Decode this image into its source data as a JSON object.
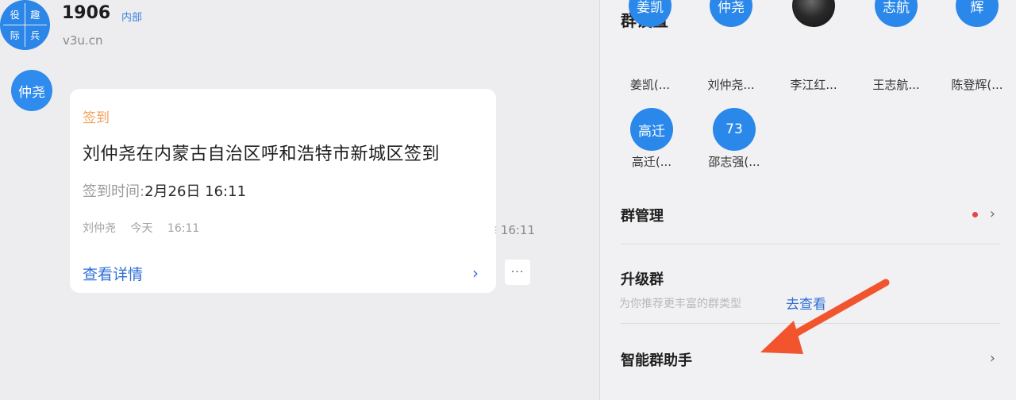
{
  "chat": {
    "group": {
      "avatar_chars": [
        "役",
        "趣",
        "际",
        "兵"
      ],
      "name": "1906",
      "tag": "内部",
      "subtitle": "v3u.cn"
    },
    "message": {
      "sender_avatar": "仲尧",
      "card": {
        "tag": "签到",
        "title": "刘仲尧在内蒙古自治区呼和浩特市新城区签到",
        "time_label": "签到时间:",
        "time_value": "2月26日 16:11",
        "meta_sender": "刘仲尧",
        "meta_day": "今天",
        "meta_time": "16:11",
        "link": "查看详情"
      },
      "time": "16:11",
      "more": "···"
    }
  },
  "settings": {
    "title": "群设置",
    "members": [
      {
        "avatar": "姜凯",
        "name": "姜凯(...",
        "photo": false
      },
      {
        "avatar": "仲尧",
        "name": "刘仲尧...",
        "photo": false
      },
      {
        "avatar": "",
        "name": "李江红...",
        "photo": true
      },
      {
        "avatar": "志航",
        "name": "王志航...",
        "photo": false
      },
      {
        "avatar": "辉",
        "name": "陈登辉(...",
        "photo": false
      },
      {
        "avatar": "高迁",
        "name": "高迁(...",
        "photo": false
      },
      {
        "avatar": "73",
        "name": "邵志强(...",
        "photo": false
      }
    ],
    "group_management": "群管理",
    "upgrade": {
      "label": "升级群",
      "description": "为你推荐更丰富的群类型",
      "action": "去查看"
    },
    "assistant": "智能群助手"
  },
  "colors": {
    "accent_blue": "#2a88ea",
    "link_blue": "#2f6fd6",
    "tag_orange": "#f2a15c",
    "notify_red": "#e54545",
    "arrow_red": "#f2542d"
  }
}
